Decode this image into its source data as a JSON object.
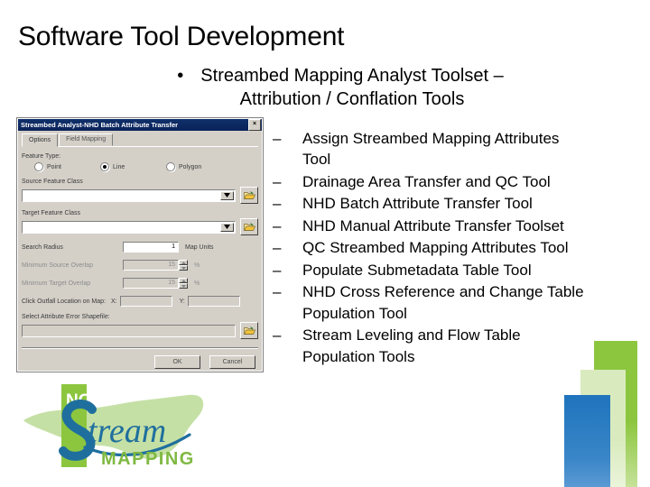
{
  "slide": {
    "title": "Software Tool Development",
    "level1": {
      "marker": "•",
      "line1": "Streambed Mapping Analyst Toolset –",
      "line2": "Attribution / Conflation Tools"
    },
    "level2_marker": "–",
    "level2_items": [
      "Assign Streambed Mapping Attributes Tool",
      "Drainage Area Transfer and QC Tool",
      "NHD Batch Attribute Transfer Tool",
      "NHD Manual Attribute Transfer Toolset",
      "QC Streambed Mapping Attributes Tool",
      "Populate Submetadata Table Tool",
      "NHD Cross Reference and Change Table Population Tool",
      "Stream Leveling and Flow Table Population Tools"
    ]
  },
  "dialog": {
    "title": "Streambed Analyst-NHD Batch Attribute Transfer",
    "close_label": "×",
    "tabs": [
      {
        "label": "Options",
        "active": true
      },
      {
        "label": "Field Mapping",
        "active": false
      }
    ],
    "feature_type_label": "Feature Type:",
    "feature_types": [
      {
        "label": "Point",
        "checked": false
      },
      {
        "label": "Line",
        "checked": true
      },
      {
        "label": "Polygon",
        "checked": false
      }
    ],
    "source_feature_class_label": "Source Feature Class",
    "source_feature_class_value": "",
    "target_feature_class_label": "Target Feature Class",
    "target_feature_class_value": "",
    "search_radius_label": "Search Radius",
    "search_radius_value": "1",
    "search_radius_unit": "Map Units",
    "min_source_overlap_label": "Minimum Source Overlap",
    "min_source_overlap_value": "15",
    "min_source_overlap_unit": "%",
    "min_target_overlap_label": "Minimum Target Overlap",
    "min_target_overlap_value": "15",
    "min_target_overlap_unit": "%",
    "outfall_label": "Click Outfall Location on Map:",
    "outfall_x_label": "X:",
    "outfall_x_value": "",
    "outfall_y_label": "Y:",
    "outfall_y_value": "",
    "error_shapefile_label": "Select Attribute Error Shapefile:",
    "error_shapefile_value": "",
    "ok_label": "OK",
    "cancel_label": "Cancel"
  },
  "logo": {
    "nc_text": "NC",
    "stream_text": "Stream",
    "mapping_text": "MAPPING",
    "colors": {
      "state_outline": "#c5e0a5",
      "bar_green": "#8cc63f",
      "script_blue": "#1f6f9e",
      "mapping_green": "#7fb942"
    }
  },
  "decoration": {
    "colors": {
      "green_dark": "#8cc63f",
      "green_light": "#d9ebbe",
      "blue": "#1f74bd"
    }
  }
}
